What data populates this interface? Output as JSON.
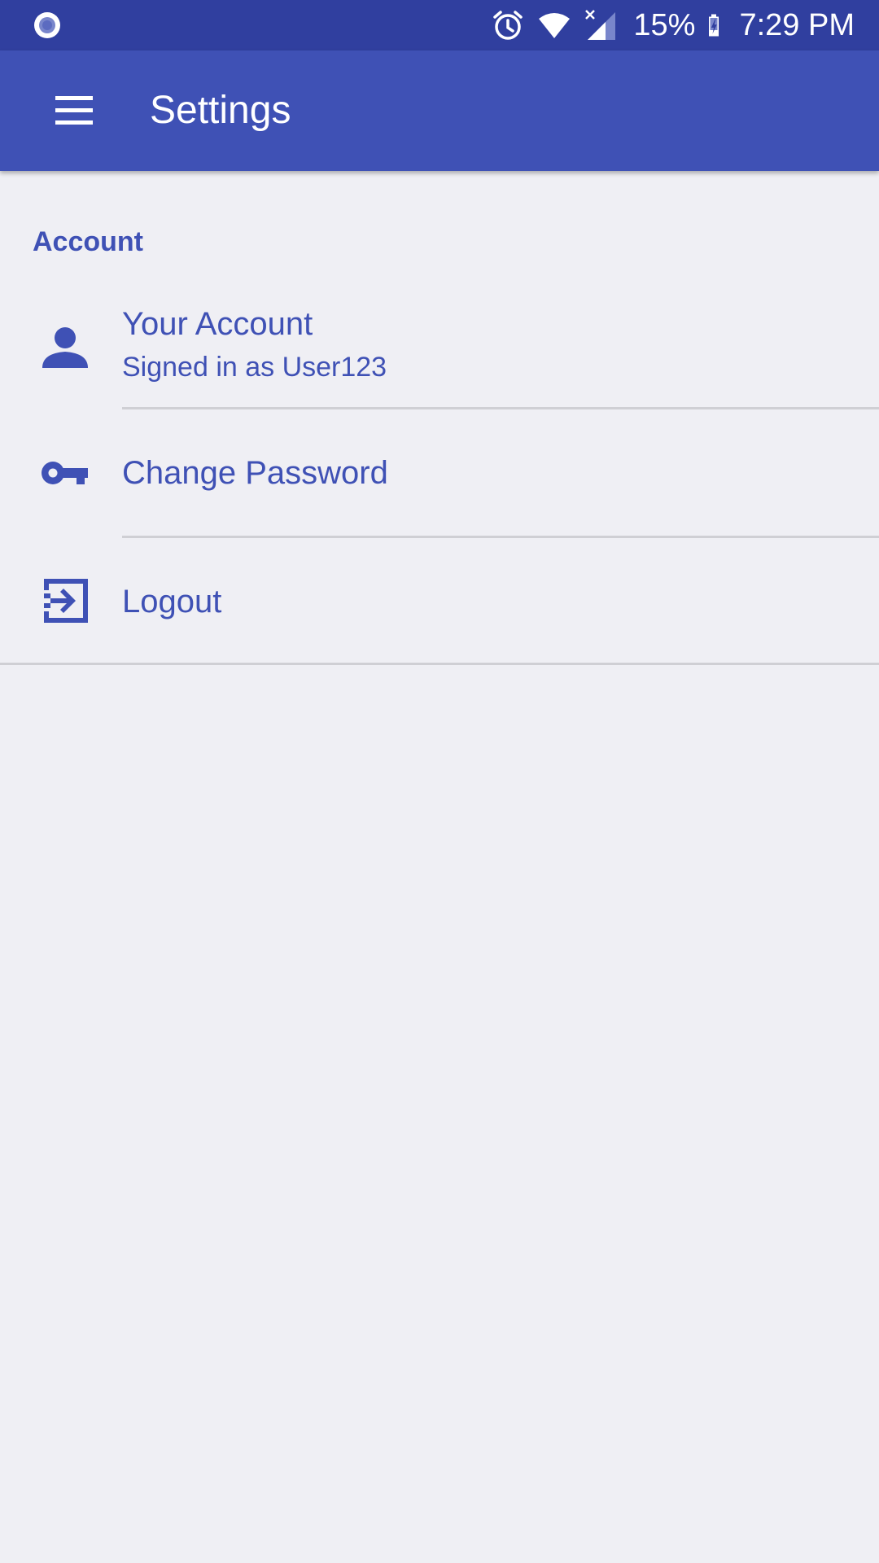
{
  "status_bar": {
    "battery_percent": "15%",
    "time": "7:29 PM",
    "icons": [
      "notification-dot-icon",
      "alarm-icon",
      "wifi-icon",
      "signal-icon",
      "battery-charging-icon"
    ]
  },
  "app_bar": {
    "title": "Settings",
    "menu_icon": "hamburger-menu-icon"
  },
  "settings": {
    "section_header": "Account",
    "items": [
      {
        "icon": "person-icon",
        "title": "Your Account",
        "summary": "Signed in as User123"
      },
      {
        "icon": "key-icon",
        "title": "Change Password"
      },
      {
        "icon": "logout-icon",
        "title": "Logout"
      }
    ]
  },
  "colors": {
    "status_bar": "#303f9f",
    "app_bar": "#3f51b5",
    "accent_text": "#3f51b5",
    "background": "#efeff4"
  }
}
